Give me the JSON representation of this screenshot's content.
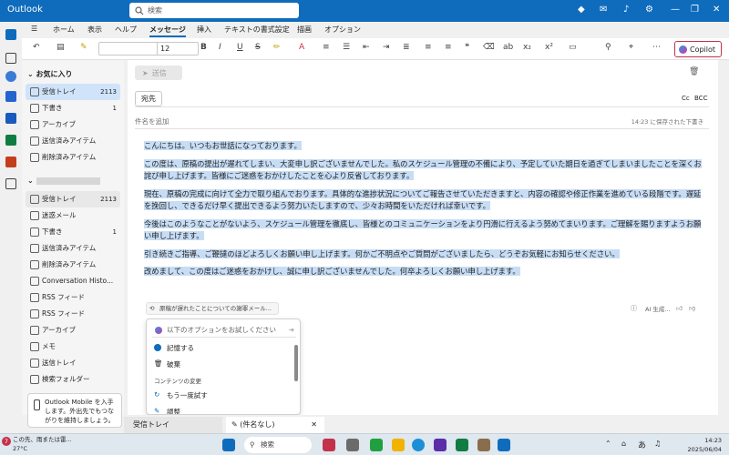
{
  "window": {
    "app_title": "Outlook",
    "search_placeholder": "検索"
  },
  "ribbon_tabs": [
    "ホーム",
    "表示",
    "ヘルプ",
    "メッセージ",
    "挿入",
    "テキストの書式設定",
    "描画",
    "オプション"
  ],
  "ribbon": {
    "font_size": "12",
    "copilot_label": "Copilot"
  },
  "folders": {
    "favorites_header": "お気に入り",
    "favorites": [
      {
        "label": "受信トレイ",
        "count": "2113"
      },
      {
        "label": "下書き",
        "count": "1"
      },
      {
        "label": "アーカイブ",
        "count": ""
      },
      {
        "label": "送信済みアイテム",
        "count": ""
      },
      {
        "label": "削除済みアイテム",
        "count": ""
      }
    ],
    "account": [
      {
        "label": "受信トレイ",
        "count": "2113"
      },
      {
        "label": "迷惑メール",
        "count": ""
      },
      {
        "label": "下書き",
        "count": "1"
      },
      {
        "label": "送信済みアイテム",
        "count": ""
      },
      {
        "label": "削除済みアイテム",
        "count": ""
      },
      {
        "label": "Conversation Histo...",
        "count": ""
      },
      {
        "label": "RSS フィード",
        "count": ""
      },
      {
        "label": "RSS フィード",
        "count": ""
      },
      {
        "label": "アーカイブ",
        "count": ""
      },
      {
        "label": "メモ",
        "count": ""
      },
      {
        "label": "送信トレイ",
        "count": ""
      },
      {
        "label": "検索フォルダー",
        "count": ""
      }
    ],
    "promo_text": "Outlook Mobile を入手します。外出先でもつながりを維持しましょう。"
  },
  "compose": {
    "send_label": "送信",
    "to_label": "宛先",
    "cc_label": "Cc",
    "bcc_label": "BCC",
    "subject_placeholder": "件名を追加",
    "saved_info": "14:23 に保存された下書き",
    "body": [
      "こんにちは。いつもお世話になっております。",
      "この度は、原稿の提出が遅れてしまい、大変申し訳ございませんでした。私のスケジュール管理の不備により、予定していた期日を過ぎてしまいましたことを深くお詫び申し上げます。皆様にご迷惑をおかけしたことを心より反省しております。",
      "現在、原稿の完成に向けて全力で取り組んでおります。具体的な進捗状況についてご報告させていただきますと、内容の確認や修正作業を進めている段階です。遅延を挽回し、できるだけ早く提出できるよう努力いたしますので、少々お時間をいただければ幸いです。",
      "今後はこのようなことがないよう、スケジュール管理を徹底し、皆様とのコミュニケーションをより円滑に行えるよう努めてまいります。ご理解を賜りますようお願い申し上げます。",
      "引き続きご指導、ご鞭撻のほどよろしくお願い申し上げます。何かご不明点やご質問がございましたら、どうぞお気軽にお知らせください。",
      "改めまして、この度はご迷惑をおかけし、誠に申し訳ございませんでした。何卒よろしくお願い申し上げます。"
    ],
    "suggestion_chip": "原稿が遅れたことについての謝罪メール...",
    "ai_label": "AI 生成..."
  },
  "copilot_popup": {
    "input_placeholder": "以下のオプションをお試しください",
    "keep_label": "記憶する",
    "discard_label": "破棄",
    "section_label": "コンテンツの変更",
    "retry_label": "もう一度試す",
    "adjust_label": "調整"
  },
  "bottom_tabs": {
    "inbox": "受信トレイ",
    "draft": "(件名なし)"
  },
  "taskbar": {
    "notification_badge": "7",
    "weather_line1": "この先、雨または雷...",
    "weather_line2": "27°C",
    "search_label": "検索",
    "ime": "あ",
    "time": "14:23",
    "date": "2025/06/04"
  },
  "colors": {
    "brand": "#0f6cbd",
    "selection": "#c7ddf5"
  }
}
